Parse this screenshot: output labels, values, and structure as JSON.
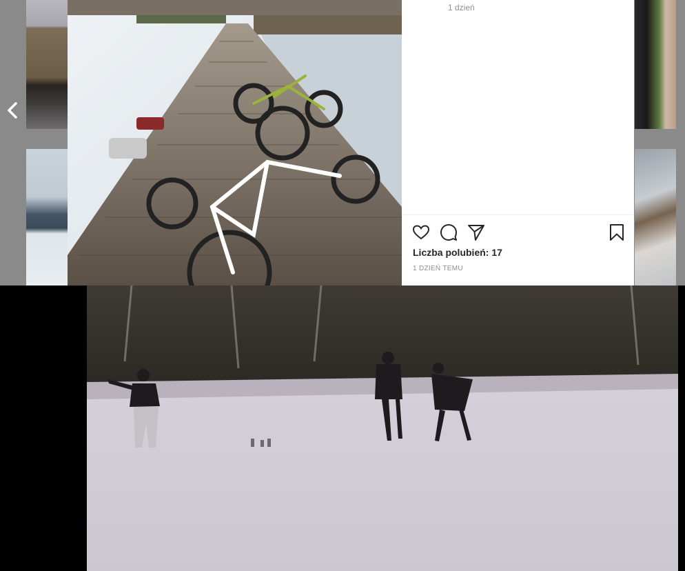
{
  "post": {
    "comment_time": "1 dzień",
    "likes": "Liczba polubień: 17",
    "posted": "1 DZIEŃ TEMU"
  },
  "icons": {
    "prev": "chevron-left-icon",
    "like": "heart-icon",
    "comment": "comment-icon",
    "share": "paper-plane-icon",
    "save": "bookmark-icon"
  },
  "colors": {
    "overlay": "#8a8a8a",
    "panel": "#ffffff",
    "text": "#262626",
    "muted": "#8e8e8e"
  }
}
